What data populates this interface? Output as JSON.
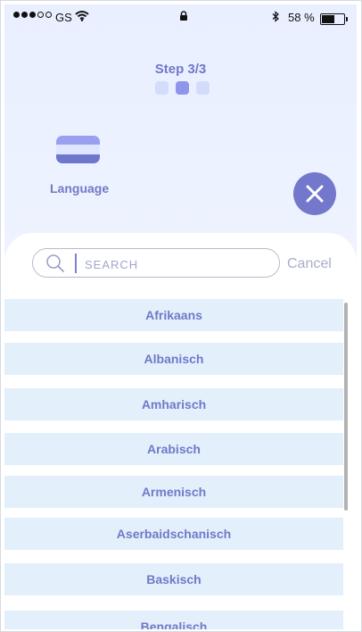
{
  "status_bar": {
    "carrier": "GS",
    "battery_text": "58 %",
    "battery_level": 0.58,
    "signal_bars": [
      true,
      true,
      true,
      false,
      false
    ]
  },
  "step": {
    "title": "Step 3/3",
    "current": 3,
    "total": 3
  },
  "language_label": "Language",
  "flag_colors": [
    "#9aa0f0",
    "#dfe6ff",
    "#6f77cc"
  ],
  "search": {
    "placeholder": "SEARCH",
    "value": "",
    "cancel_label": "Cancel"
  },
  "languages": [
    "Afrikaans",
    "Albanisch",
    "Amharisch",
    "Arabisch",
    "Armenisch",
    "Aserbaidschanisch",
    "Baskisch",
    "Bengalisch"
  ],
  "colors": {
    "accent": "#7378cc",
    "list_bg": "#e3f0fc"
  }
}
